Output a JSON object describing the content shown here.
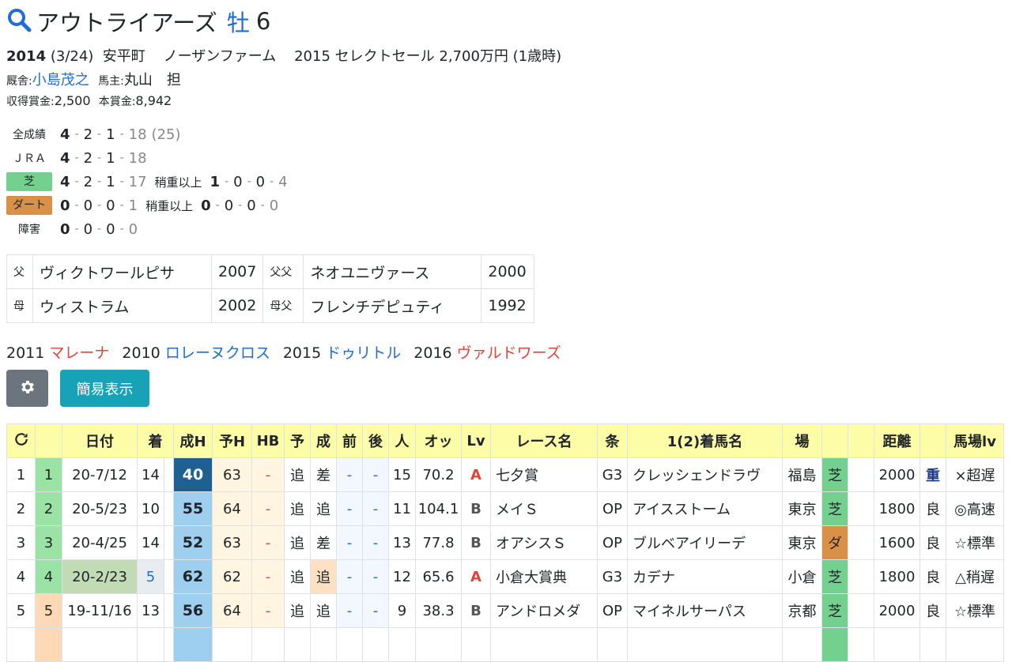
{
  "horse": {
    "name": "アウトライアーズ",
    "sex": "牡",
    "age": "6",
    "birth_year": "2014",
    "birth_date": "(3/24)",
    "birthplace": "安平町",
    "breeder": "ノーザンファーム",
    "sale": "2015 セレクトセール 2,700万円 (1歳時)",
    "trainer_label": "厩舎:",
    "trainer": "小島茂之",
    "owner_label": "馬主:",
    "owner": "丸山　担",
    "earnings_label": "収得賞金:",
    "earnings": "2,500",
    "prize_label": "本賞金:",
    "prize": "8,942"
  },
  "records": [
    {
      "label": "全成績",
      "w": "4",
      "p2": "2",
      "p3": "1",
      "o": "18",
      "extra": "(25)"
    },
    {
      "label": "ＪＲＡ",
      "w": "4",
      "p2": "2",
      "p3": "1",
      "o": "18"
    },
    {
      "label": "芝",
      "w": "4",
      "p2": "2",
      "p3": "1",
      "o": "17",
      "sub_label": "稍重以上",
      "sw": "1",
      "sp2": "0",
      "sp3": "0",
      "so": "4"
    },
    {
      "label": "ダート",
      "w": "0",
      "p2": "0",
      "p3": "0",
      "o": "1",
      "sub_label": "稍重以上",
      "sw": "0",
      "sp2": "0",
      "sp3": "0",
      "so": "0"
    },
    {
      "label": "障害",
      "w": "0",
      "p2": "0",
      "p3": "0",
      "o": "0"
    }
  ],
  "pedigree": {
    "sire_label": "父",
    "sire": "ヴィクトワールピサ",
    "sire_year": "2007",
    "sire_sire_label": "父父",
    "sire_sire": "ネオユニヴァース",
    "sire_sire_year": "2000",
    "dam_label": "母",
    "dam": "ウィストラム",
    "dam_year": "2002",
    "dam_sire_label": "母父",
    "dam_sire": "フレンチデピュティ",
    "dam_sire_year": "1992"
  },
  "siblings": [
    {
      "year": "2011",
      "name": "マレーナ",
      "color": "red"
    },
    {
      "year": "2010",
      "name": "ロレーヌクロス",
      "color": "blue"
    },
    {
      "year": "2015",
      "name": "ドゥリトル",
      "color": "blue"
    },
    {
      "year": "2016",
      "name": "ヴァルドワーズ",
      "color": "red"
    }
  ],
  "buttons": {
    "simple": "簡易表示"
  },
  "table": {
    "headers": [
      "日付",
      "着",
      "成H",
      "予H",
      "HB",
      "予",
      "成",
      "前",
      "後",
      "人",
      "オッ",
      "Lv",
      "レース名",
      "条",
      "1(2)着馬名",
      "場",
      "",
      "",
      "距離",
      "",
      "馬場lv"
    ],
    "rows": [
      {
        "no": "1",
        "order": "1",
        "date": "20-7/12",
        "finish": "14",
        "seih": "40",
        "yoh": "63",
        "hb": "-",
        "yo": "追",
        "sei": "差",
        "mae": "-",
        "ato": "-",
        "ninki": "15",
        "odds": "70.2",
        "lv": "A",
        "race": "七夕賞",
        "cond": "G3",
        "winner": "クレッシェンドラヴ",
        "place": "福島",
        "surface": "芝",
        "dist": "2000",
        "baba": "重",
        "babalv": "×超遅"
      },
      {
        "no": "2",
        "order": "2",
        "date": "20-5/23",
        "finish": "10",
        "seih": "55",
        "yoh": "64",
        "hb": "-",
        "yo": "追",
        "sei": "追",
        "mae": "-",
        "ato": "-",
        "ninki": "11",
        "odds": "104.1",
        "lv": "B",
        "race": "メイＳ",
        "cond": "OP",
        "winner": "アイスストーム",
        "place": "東京",
        "surface": "芝",
        "dist": "1800",
        "baba": "良",
        "babalv": "◎高速"
      },
      {
        "no": "3",
        "order": "3",
        "date": "20-4/25",
        "finish": "14",
        "seih": "52",
        "yoh": "63",
        "hb": "-",
        "yo": "追",
        "sei": "差",
        "mae": "-",
        "ato": "-",
        "ninki": "13",
        "odds": "77.8",
        "lv": "B",
        "race": "オアシスＳ",
        "cond": "OP",
        "winner": "ブルベアイリーデ",
        "place": "東京",
        "surface": "ダ",
        "dist": "1600",
        "baba": "良",
        "babalv": "☆標準"
      },
      {
        "no": "4",
        "order": "4",
        "date": "20-2/23",
        "finish": "5",
        "seih": "62",
        "yoh": "62",
        "hb": "-",
        "yo": "追",
        "sei": "追",
        "mae": "-",
        "ato": "-",
        "ninki": "12",
        "odds": "65.6",
        "lv": "A",
        "race": "小倉大賞典",
        "cond": "G3",
        "winner": "カデナ",
        "place": "小倉",
        "surface": "芝",
        "dist": "1800",
        "baba": "良",
        "babalv": "△稍遅"
      },
      {
        "no": "5",
        "order": "5",
        "date": "19-11/16",
        "finish": "13",
        "seih": "56",
        "yoh": "64",
        "hb": "-",
        "yo": "追",
        "sei": "追",
        "mae": "-",
        "ato": "-",
        "ninki": "9",
        "odds": "38.3",
        "lv": "B",
        "race": "アンドロメダ",
        "cond": "OP",
        "winner": "マイネルサーパス",
        "place": "京都",
        "surface": "芝",
        "dist": "2000",
        "baba": "良",
        "babalv": "☆標準"
      }
    ]
  }
}
